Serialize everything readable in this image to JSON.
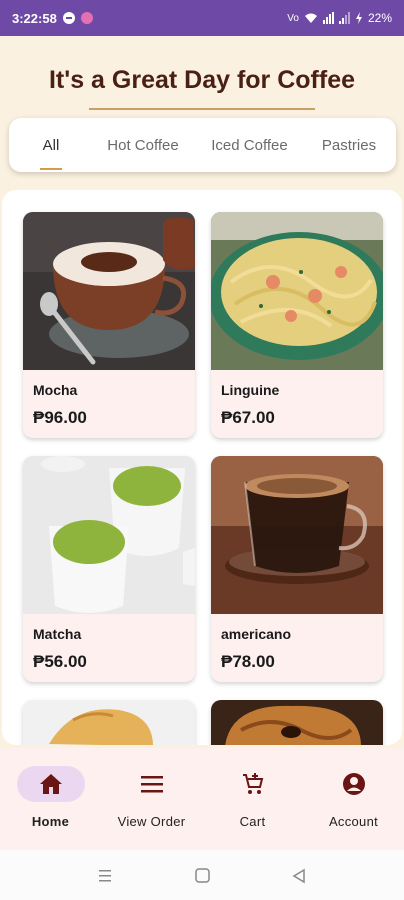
{
  "status_bar": {
    "time": "3:22:58",
    "battery": "22%",
    "network_label": "Vo"
  },
  "header": {
    "title": "It's a Great Day for Coffee"
  },
  "tabs": [
    {
      "label": "All",
      "active": true
    },
    {
      "label": "Hot Coffee",
      "active": false
    },
    {
      "label": "Iced Coffee",
      "active": false
    },
    {
      "label": "Pastries",
      "active": false
    }
  ],
  "products": [
    {
      "name": "Mocha",
      "price": "₱96.00",
      "image": "mocha-photo"
    },
    {
      "name": "Linguine",
      "price": "₱67.00",
      "image": "linguine-photo"
    },
    {
      "name": "Matcha",
      "price": "₱56.00",
      "image": "matcha-photo"
    },
    {
      "name": "americano",
      "price": "₱78.00",
      "image": "americano-photo"
    }
  ],
  "bottom_nav": [
    {
      "label": "Home",
      "icon": "home-icon",
      "active": true
    },
    {
      "label": "View Order",
      "icon": "menu-icon",
      "active": false
    },
    {
      "label": "Cart",
      "icon": "cart-icon",
      "active": false
    },
    {
      "label": "Account",
      "icon": "account-icon",
      "active": false
    }
  ],
  "colors": {
    "accent": "#6e4aa6",
    "brand_dark": "#4a1f14",
    "nav_icon": "#6b1414",
    "background": "#fbf1e1"
  }
}
